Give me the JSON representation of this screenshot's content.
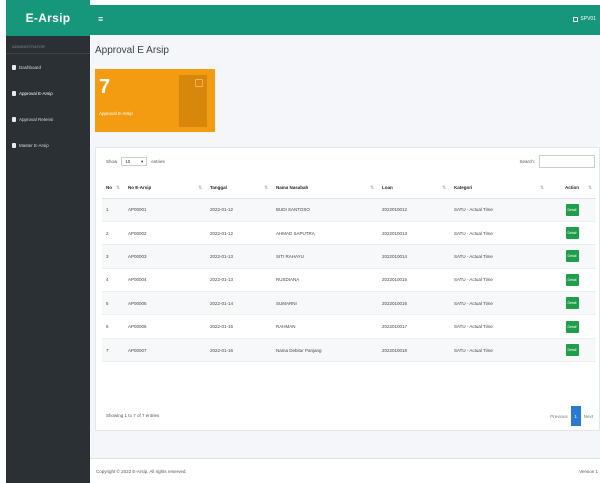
{
  "app": {
    "brand": "E-Arsip"
  },
  "sidebar": {
    "user_label": "ADMINISTRATOR",
    "items": [
      {
        "label": "Dashboard"
      },
      {
        "label": "Approval E-Arsip"
      },
      {
        "label": "Approval Retensi"
      },
      {
        "label": "Master E-Arsip"
      }
    ]
  },
  "topbar": {
    "toggle_icon": "bars-icon",
    "user_label": "SPV01"
  },
  "page": {
    "title": "Approval E Arsip"
  },
  "stat_card": {
    "value": "7",
    "label": "Approval E-Arsip",
    "color": "#f39c12"
  },
  "table_controls": {
    "show_label": "Show",
    "entries_value": "10",
    "entries_suffix": "entries",
    "search_label": "Search:"
  },
  "table": {
    "columns": [
      "No",
      "No E-Arsip",
      "Tanggal",
      "Nama Nasabah",
      "Loan",
      "Kategori",
      "Action"
    ],
    "rows": [
      {
        "no": "1",
        "arsip": "AP00001",
        "tanggal": "2022-01-12",
        "nama": "BUDI SANTOSO",
        "loan": "2022010012",
        "kategori": "SATU - Actual Time",
        "action": "Detail"
      },
      {
        "no": "2",
        "arsip": "AP00002",
        "tanggal": "2022-01-12",
        "nama": "AHMAD SAPUTRA",
        "loan": "2022010013",
        "kategori": "SATU - Actual Time",
        "action": "Detail"
      },
      {
        "no": "3",
        "arsip": "AP00003",
        "tanggal": "2022-01-13",
        "nama": "SITI RAHAYU",
        "loan": "2022010014",
        "kategori": "SATU - Actual Time",
        "action": "Detail"
      },
      {
        "no": "4",
        "arsip": "AP00004",
        "tanggal": "2022-01-13",
        "nama": "RUSDIANA",
        "loan": "2022010015",
        "kategori": "SATU - Actual Time",
        "action": "Detail"
      },
      {
        "no": "5",
        "arsip": "AP00005",
        "tanggal": "2022-01-14",
        "nama": "SUMARNI",
        "loan": "2022010016",
        "kategori": "SATU - Actual Time",
        "action": "Detail"
      },
      {
        "no": "6",
        "arsip": "AP00006",
        "tanggal": "2022-01-15",
        "nama": "RAHMAN",
        "loan": "2022010017",
        "kategori": "SATU - Actual Time",
        "action": "Detail"
      },
      {
        "no": "7",
        "arsip": "AP00007",
        "tanggal": "2022-01-16",
        "nama": "Nama Debitur Panjang",
        "loan": "2022010018",
        "kategori": "SATU - Actual Time",
        "action": "Detail"
      }
    ]
  },
  "pagination": {
    "info": "Showing 1 to 7 of 7 entries",
    "previous": "Previous",
    "current": "1",
    "next": "Next"
  },
  "footer": {
    "copyright": "Copyright © 2022 E-Arsip. All rights reserved.",
    "version": "Version 1"
  },
  "colors": {
    "brand": "#16967a",
    "sidebar": "#2b3035",
    "action": "#1e9e4a",
    "page_active": "#2a7ad1"
  }
}
